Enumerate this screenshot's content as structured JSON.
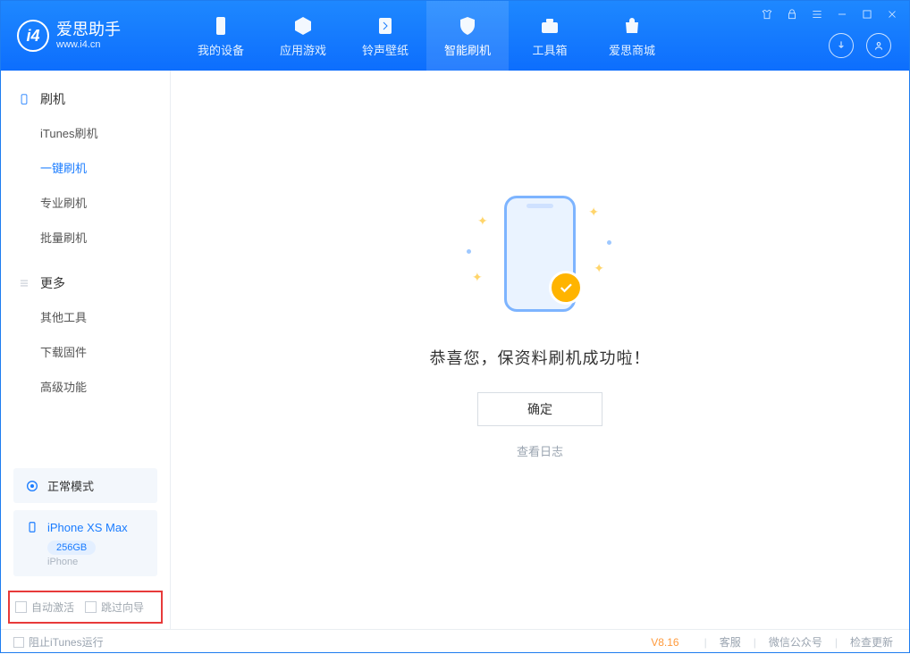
{
  "app": {
    "name": "爱思助手",
    "url": "www.i4.cn"
  },
  "nav": [
    {
      "label": "我的设备"
    },
    {
      "label": "应用游戏"
    },
    {
      "label": "铃声壁纸"
    },
    {
      "label": "智能刷机"
    },
    {
      "label": "工具箱"
    },
    {
      "label": "爱思商城"
    }
  ],
  "sidebar": {
    "group1": {
      "title": "刷机",
      "items": [
        {
          "label": "iTunes刷机"
        },
        {
          "label": "一键刷机"
        },
        {
          "label": "专业刷机"
        },
        {
          "label": "批量刷机"
        }
      ]
    },
    "group2": {
      "title": "更多",
      "items": [
        {
          "label": "其他工具"
        },
        {
          "label": "下载固件"
        },
        {
          "label": "高级功能"
        }
      ]
    },
    "mode": "正常模式",
    "device": {
      "name": "iPhone XS Max",
      "storage": "256GB",
      "type": "iPhone"
    },
    "checks": {
      "auto_activate": "自动激活",
      "skip_guide": "跳过向导"
    }
  },
  "main": {
    "success": "恭喜您，保资料刷机成功啦！",
    "ok": "确定",
    "view_log": "查看日志"
  },
  "footer": {
    "block_itunes": "阻止iTunes运行",
    "version": "V8.16",
    "links": {
      "service": "客服",
      "wechat": "微信公众号",
      "update": "检查更新"
    }
  }
}
